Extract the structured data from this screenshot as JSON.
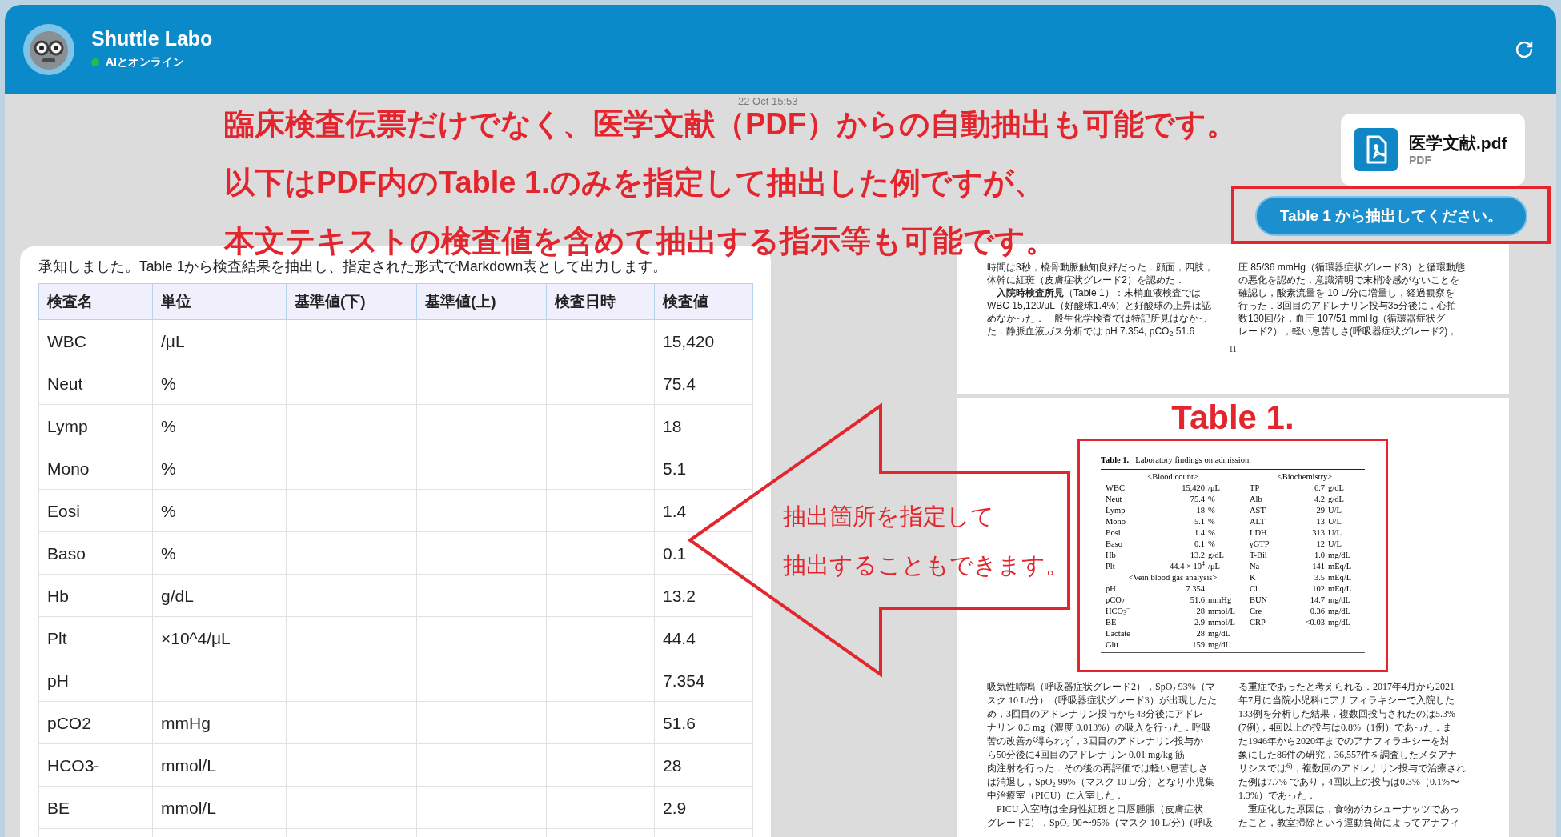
{
  "header": {
    "title": "Shuttle Labo",
    "status": "AIとオンライン",
    "online": true
  },
  "timestamp": "22 Oct 15:53",
  "annotations": {
    "lines": [
      "臨床検査伝票だけでなく、医学文献（PDF）からの自動抽出も可能です。",
      "以下はPDF内のTable 1.のみを指定して抽出した例ですが、",
      "本文テキストの検査値を含めて抽出する指示等も可能です。"
    ],
    "arrow_text": [
      "抽出箇所を指定して",
      "抽出することもできます。"
    ],
    "table_label": "Table 1."
  },
  "attachment": {
    "name": "医学文献.pdf",
    "type": "PDF"
  },
  "user_message": "Table 1 から抽出してください。",
  "reply": {
    "intro": "承知しました。Table 1から検査結果を抽出し、指定された形式でMarkdown表として出力します。",
    "columns": [
      "検査名",
      "単位",
      "基準値(下)",
      "基準値(上)",
      "検査日時",
      "検査値"
    ],
    "rows": [
      {
        "name": "WBC",
        "unit": "/μL",
        "value": "15,420"
      },
      {
        "name": "Neut",
        "unit": "%",
        "value": "75.4"
      },
      {
        "name": "Lymp",
        "unit": "%",
        "value": "18"
      },
      {
        "name": "Mono",
        "unit": "%",
        "value": "5.1"
      },
      {
        "name": "Eosi",
        "unit": "%",
        "value": "1.4"
      },
      {
        "name": "Baso",
        "unit": "%",
        "value": "0.1"
      },
      {
        "name": "Hb",
        "unit": "g/dL",
        "value": "13.2"
      },
      {
        "name": "Plt",
        "unit": "×10^4/μL",
        "value": "44.4"
      },
      {
        "name": "pH",
        "value": "7.354"
      },
      {
        "name": "pCO2",
        "unit": "mmHg",
        "value": "51.6"
      },
      {
        "name": "HCO3-",
        "unit": "mmol/L",
        "value": "28"
      },
      {
        "name": "BE",
        "unit": "mmol/L",
        "value": "2.9"
      }
    ]
  },
  "pdf": {
    "page1": {
      "columns": [
        [
          "時間は3秒，橈骨動脈触知良好だった．顔面，四肢，",
          "体幹に紅斑（皮膚症状グレード2）を認めた．",
          "　**入院時検査所見**（Table 1）：末梢血液検査では",
          "WBC 15,120/μL（好酸球1.4%）と好酸球の上昇は認",
          "めなかった．一般生化学検査では特記所見はなかっ",
          "た．静脈血液ガス分析では pH 7.354, pCO$_{2}$ 51.6"
        ],
        [
          "圧 85/36 mmHg（循環器症状グレード3）と循環動態",
          "の悪化を認めた．意識清明で末梢冷感がないことを",
          "確認し，酸素流量を 10 L/分に増量し，経過観察を",
          "行った．3回目のアドレナリン投与35分後に，心拍",
          "数130回/分，血圧 107/51 mmHg（循環器症状グ",
          "レード2），軽い息苦しさ(呼吸器症状グレード2)，"
        ]
      ],
      "page_number": "—11—"
    },
    "table": {
      "title_label": "Table 1.",
      "title": "Laboratory findings on admission.",
      "columns": [
        [
          {
            "kind": "heading",
            "text": "<Blood count>"
          },
          {
            "kind": "row",
            "name": "WBC",
            "value": "15,420",
            "unit": "/μL"
          },
          {
            "kind": "row",
            "name": "Neut",
            "value": "75.4",
            "unit": "%"
          },
          {
            "kind": "row",
            "name": "Lymp",
            "value": "18",
            "unit": "%"
          },
          {
            "kind": "row",
            "name": "Mono",
            "value": "5.1",
            "unit": "%"
          },
          {
            "kind": "row",
            "name": "Eosi",
            "value": "1.4",
            "unit": "%"
          },
          {
            "kind": "row",
            "name": "Baso",
            "value": "0.1",
            "unit": "%"
          },
          {
            "kind": "row",
            "name": "Hb",
            "value": "13.2",
            "unit": "g/dL"
          },
          {
            "kind": "row",
            "name": "Plt",
            "value": "44.4 × 10$^{4}$",
            "unit": "/μL"
          },
          {
            "kind": "heading",
            "text": "<Vein blood gas analysis>"
          },
          {
            "kind": "row",
            "name": "pH",
            "value": "7.354"
          },
          {
            "kind": "row",
            "name": "pCO$_{2}$",
            "value": "51.6",
            "unit": "mmHg"
          },
          {
            "kind": "row",
            "name": "HCO$_{3}$$^{−}$",
            "value": "28",
            "unit": "mmol/L"
          },
          {
            "kind": "row",
            "name": "BE",
            "value": "2.9",
            "unit": "mmol/L"
          },
          {
            "kind": "row",
            "name": "Lactate",
            "value": "28",
            "unit": "mg/dL"
          },
          {
            "kind": "row",
            "name": "Glu",
            "value": "159",
            "unit": "mg/dL"
          }
        ],
        [
          {
            "kind": "heading",
            "text": "<Biochemistry>"
          },
          {
            "kind": "row",
            "name": "TP",
            "value": "6.7",
            "unit": "g/dL"
          },
          {
            "kind": "row",
            "name": "Alb",
            "value": "4.2",
            "unit": "g/dL"
          },
          {
            "kind": "row",
            "name": "AST",
            "value": "29",
            "unit": "U/L"
          },
          {
            "kind": "row",
            "name": "ALT",
            "value": "13",
            "unit": "U/L"
          },
          {
            "kind": "row",
            "name": "LDH",
            "value": "313",
            "unit": "U/L"
          },
          {
            "kind": "row",
            "name": "γGTP",
            "value": "12",
            "unit": "U/L"
          },
          {
            "kind": "row",
            "name": "T-Bil",
            "value": "1.0",
            "unit": "mg/dL"
          },
          {
            "kind": "row",
            "name": "Na",
            "value": "141",
            "unit": "mEq/L"
          },
          {
            "kind": "row",
            "name": "K",
            "value": "3.5",
            "unit": "mEq/L"
          },
          {
            "kind": "row",
            "name": "Cl",
            "value": "102",
            "unit": "mEq/L"
          },
          {
            "kind": "row",
            "name": "BUN",
            "value": "14.7",
            "unit": "mg/dL"
          },
          {
            "kind": "row",
            "name": "Cre",
            "value": "0.36",
            "unit": "mg/dL"
          },
          {
            "kind": "row",
            "name": "CRP",
            "value": "<0.03",
            "unit": "mg/dL"
          }
        ]
      ]
    },
    "page2": {
      "columns": [
        [
          "吸気性喘鳴（呼吸器症状グレード2），SpO$_{2}$ 93%（マ",
          "スク 10 L/分）（呼吸器症状グレード3）が出現したた",
          "め，3回目のアドレナリン投与から43分後にアドレ",
          "ナリン 0.3 mg（濃度 0.013%）の吸入を行った．呼吸",
          "苦の改善が得られず，3回目のアドレナリン投与か",
          "ら50分後に4回目のアドレナリン 0.01 mg/kg 筋",
          "肉注射を行った．その後の再評価では軽い息苦しさ",
          "は消退し，SpO$_{2}$ 99%（マスク 10 L/分）となり小児集",
          "中治療室（PICU）に入室した．",
          "　PICU 入室時は全身性紅斑と口唇腫脹（皮膚症状",
          "グレード2），SpO$_{2}$ 90〜95%（マスク 10 L/分）(呼吸"
        ],
        [
          "る重症であったと考えられる．2017年4月から2021",
          "年7月に当院小児科にアナフィラキシーで入院した",
          "133例を分析した結果，複数回投与されたのは5.3%",
          "(7例)，4回以上の投与は0.8%（1例）であった．ま",
          "た1946年から2020年までのアナフィラキシーを対",
          "象にした86件の研究，36,557件を調査したメタアナ",
          "リシスでは$^{6)}$，複数回のアドレナリン投与で治療され",
          "た例は7.7% であり，4回以上の投与は0.3%（0.1%〜",
          "1.3%）であった．",
          "　重症化した原因は，食物がカシューナッツであっ",
          "たこと，教室掃除という運動負荷によってアナフィ"
        ]
      ]
    }
  }
}
